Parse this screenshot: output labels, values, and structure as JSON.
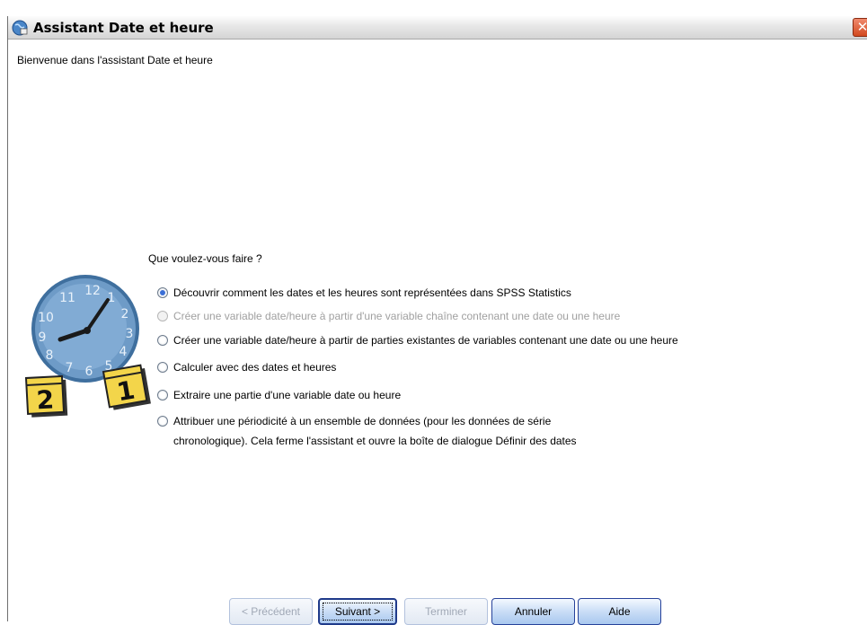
{
  "window": {
    "title": "Assistant Date et heure",
    "close_glyph": "✕"
  },
  "welcome_text": "Bienvenue dans l'assistant Date et heure",
  "question": "Que voulez-vous faire ?",
  "options": [
    {
      "label": "Découvrir comment les dates et les heures sont représentées dans SPSS Statistics",
      "selected": true,
      "enabled": true
    },
    {
      "label": "Créer une variable date/heure à partir d'une variable chaîne contenant une date ou une heure",
      "selected": false,
      "enabled": false
    },
    {
      "label": "Créer une variable date/heure à partir de parties existantes de variables contenant une date ou une heure",
      "selected": false,
      "enabled": true
    },
    {
      "label": "Calculer avec des dates et heures",
      "selected": false,
      "enabled": true
    },
    {
      "label": "Extraire une partie d'une variable date ou heure",
      "selected": false,
      "enabled": true
    },
    {
      "label_line1": "Attribuer une périodicité à un ensemble de données (pour les données de série",
      "label_line2": "chronologique). Cela ferme l'assistant et ouvre la boîte de dialogue Définir des dates",
      "selected": false,
      "enabled": true
    }
  ],
  "illustration": {
    "icon": "clock-calendar-icon",
    "clock_numbers": [
      "12",
      "1",
      "2",
      "3",
      "4",
      "5",
      "6",
      "7",
      "8",
      "9",
      "10",
      "11"
    ],
    "calendar_left": "2",
    "calendar_right": "1"
  },
  "buttons": {
    "previous": "< Précédent",
    "next": "Suivant >",
    "finish": "Terminer",
    "cancel": "Annuler",
    "help": "Aide"
  },
  "colors": {
    "selected_radio": "#3b6fd6",
    "clock_face": "#6e9bc7",
    "calendar_yellow": "#f3d54a",
    "button_border": "#27429a"
  }
}
